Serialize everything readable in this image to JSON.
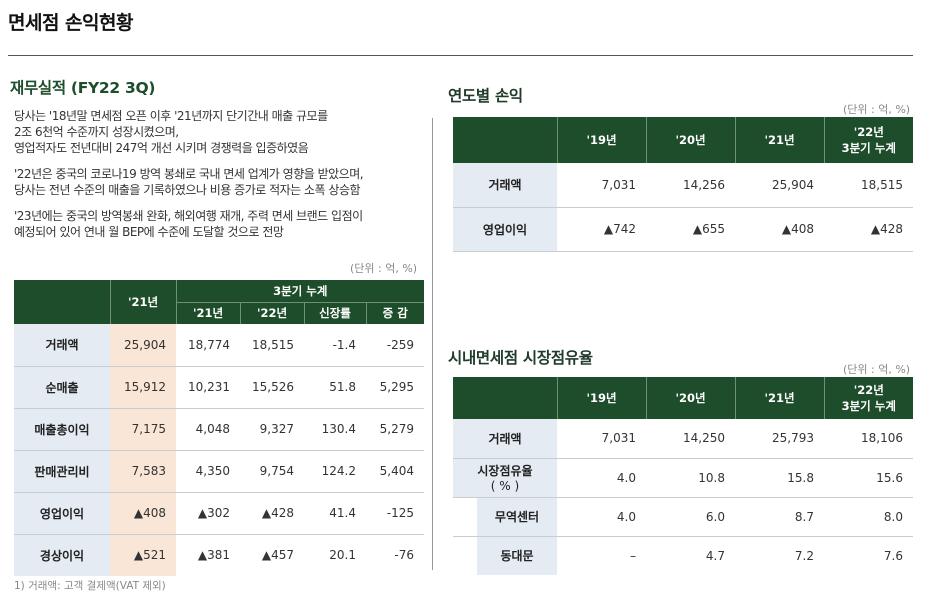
{
  "page_title": "면세점 손익현황",
  "left": {
    "title": "재무실적 (FY22 3Q)",
    "desc": [
      [
        "당사는 '18년말 면세점 오픈 이후 '21년까지 단기간내 매출 규모를",
        "2조 6천억 수준까지 성장시켰으며,",
        "영업적자도 전년대비 247억 개선 시키며 경쟁력을 입증하였음"
      ],
      [
        "'22년은 중국의 코로나19 방역 봉쇄로 국내 면세 업계가 영향을 받았으며,",
        "당사는 전년 수준의 매출을 기록하였으나 비용 증가로 적자는 소폭 상승함"
      ],
      [
        "'23년에는 중국의 방역봉쇄 완화, 해외여행 재개, 주력 면세 브랜드 입점이",
        "예정되어 있어 연내 월 BEP에 수준에 도달할 것으로 전망"
      ]
    ],
    "unit": "(단위 : 억, %)",
    "table": {
      "h_year": "'21년",
      "h_group": "3분기 누계",
      "h_sub": [
        "'21년",
        "'22년",
        "신장률",
        "증 감"
      ],
      "rows": [
        {
          "label": "거래액",
          "v": [
            "25,904",
            "18,774",
            "18,515",
            "-1.4",
            "-259"
          ]
        },
        {
          "label": "순매출",
          "v": [
            "15,912",
            "10,231",
            "15,526",
            "51.8",
            "5,295"
          ]
        },
        {
          "label": "매출총이익",
          "v": [
            "7,175",
            "4,048",
            "9,327",
            "130.4",
            "5,279"
          ]
        },
        {
          "label": "판매관리비",
          "v": [
            "7,583",
            "4,350",
            "9,754",
            "124.2",
            "5,404"
          ]
        },
        {
          "label": "영업이익",
          "v": [
            "▲408",
            "▲302",
            "▲428",
            "41.4",
            "-125"
          ]
        },
        {
          "label": "경상이익",
          "v": [
            "▲521",
            "▲381",
            "▲457",
            "20.1",
            "-76"
          ]
        }
      ]
    },
    "footnote": "1) 거래액: 고객 결제액(VAT 제외)"
  },
  "right_top": {
    "title": "연도별 손익",
    "unit": "(단위 : 억, %)",
    "headers": [
      "'19년",
      "'20년",
      "'21년",
      "'22년",
      "3분기 누계"
    ],
    "rows": [
      {
        "label": "거래액",
        "v": [
          "7,031",
          "14,256",
          "25,904",
          "18,515"
        ]
      },
      {
        "label": "영업이익",
        "v": [
          "▲742",
          "▲655",
          "▲408",
          "▲428"
        ]
      }
    ]
  },
  "right_bottom": {
    "title": "시내면세점 시장점유율",
    "unit": "(단위 : 억, %)",
    "headers": [
      "'19년",
      "'20년",
      "'21년",
      "'22년",
      "3분기 누계"
    ],
    "rows": [
      {
        "label": "거래액",
        "v": [
          "7,031",
          "14,250",
          "25,793",
          "18,106"
        ]
      },
      {
        "label": "시장점유율",
        "label2": "( % )",
        "v": [
          "4.0",
          "10.8",
          "15.8",
          "15.6"
        ]
      },
      {
        "label": "무역센터",
        "v": [
          "4.0",
          "6.0",
          "8.7",
          "8.0"
        ]
      },
      {
        "label": "동대문",
        "v": [
          "–",
          "4.7",
          "7.2",
          "7.6"
        ]
      }
    ]
  }
}
